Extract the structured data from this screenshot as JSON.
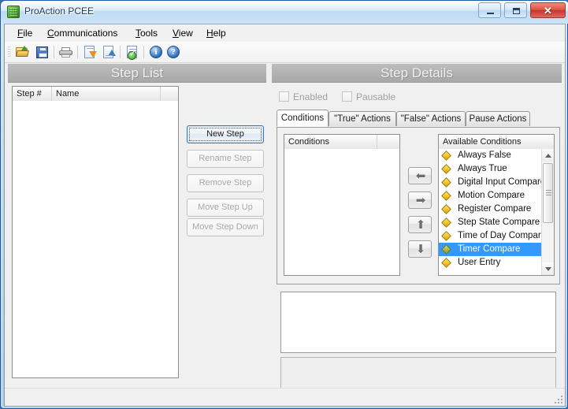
{
  "window": {
    "title": "ProAction PCEE",
    "app_icon": "app-green-icon",
    "caption": {
      "minimize": "minimize-icon",
      "maximize": "maximize-icon",
      "close": "✕"
    }
  },
  "menubar": {
    "items": [
      {
        "label": "File",
        "accel": "F"
      },
      {
        "label": "Communications",
        "accel": "C"
      },
      {
        "label": "Tools",
        "accel": "T"
      },
      {
        "label": "View",
        "accel": "V"
      },
      {
        "label": "Help",
        "accel": "H"
      }
    ]
  },
  "toolbar": {
    "buttons": [
      {
        "name": "open-file-icon",
        "tip": "Open"
      },
      {
        "name": "save-file-icon",
        "tip": "Save"
      },
      {
        "name": "print-icon",
        "tip": "Print"
      },
      {
        "name": "download-icon",
        "tip": "Download"
      },
      {
        "name": "upload-icon",
        "tip": "Upload"
      },
      {
        "name": "verify-document-icon",
        "tip": "Verify"
      },
      {
        "name": "info-icon",
        "tip": "Info",
        "glyph": "i"
      },
      {
        "name": "help-icon",
        "tip": "Help",
        "glyph": "?"
      }
    ]
  },
  "step_list": {
    "title": "Step List",
    "columns": [
      "Step #",
      "Name"
    ],
    "rows": [],
    "buttons": [
      {
        "label": "New Step",
        "state": "default"
      },
      {
        "label": "Rename Step",
        "state": "disabled"
      },
      {
        "label": "Remove Step",
        "state": "disabled"
      },
      {
        "label": "Move Step Up",
        "state": "disabled"
      },
      {
        "label": "Move Step Down",
        "state": "disabled"
      }
    ]
  },
  "step_details": {
    "title": "Step Details",
    "checkboxes": [
      {
        "label": "Enabled",
        "checked": false,
        "enabled": false
      },
      {
        "label": "Pausable",
        "checked": false,
        "enabled": false
      }
    ],
    "tabs": [
      {
        "label": "Conditions",
        "active": true
      },
      {
        "label": "\"True\" Actions",
        "active": false
      },
      {
        "label": "\"False\" Actions",
        "active": false
      },
      {
        "label": "Pause Actions",
        "active": false
      }
    ],
    "conditions_list": {
      "columns": [
        "Conditions",
        ""
      ],
      "rows": []
    },
    "transfer_buttons": [
      {
        "name": "move-left-button",
        "glyph": "⬅"
      },
      {
        "name": "move-right-button",
        "glyph": "➡"
      },
      {
        "name": "move-up-button",
        "glyph": "⬆"
      },
      {
        "name": "move-down-button",
        "glyph": "⬇"
      }
    ],
    "available_conditions": {
      "header": "Available Conditions",
      "items": [
        {
          "label": "Always False",
          "selected": false
        },
        {
          "label": "Always True",
          "selected": false
        },
        {
          "label": "Digital Input Compare",
          "selected": false
        },
        {
          "label": "Motion Compare",
          "selected": false
        },
        {
          "label": "Register Compare",
          "selected": false
        },
        {
          "label": "Step State Compare",
          "selected": false
        },
        {
          "label": "Time of Day Compare",
          "selected": false
        },
        {
          "label": "Timer Compare",
          "selected": true
        },
        {
          "label": "User Entry",
          "selected": false
        }
      ]
    },
    "detail_pane": "",
    "description_pane": ""
  },
  "statusbar": {
    "text": ""
  },
  "colors": {
    "panel_header_bg": "#b2b2b2",
    "panel_header_text": "#efefef",
    "selection_blue": "#3399ff",
    "default_button_border": "#2e7cc4",
    "diamond_gold": "#f6c51f",
    "title_text": "#16395c"
  }
}
